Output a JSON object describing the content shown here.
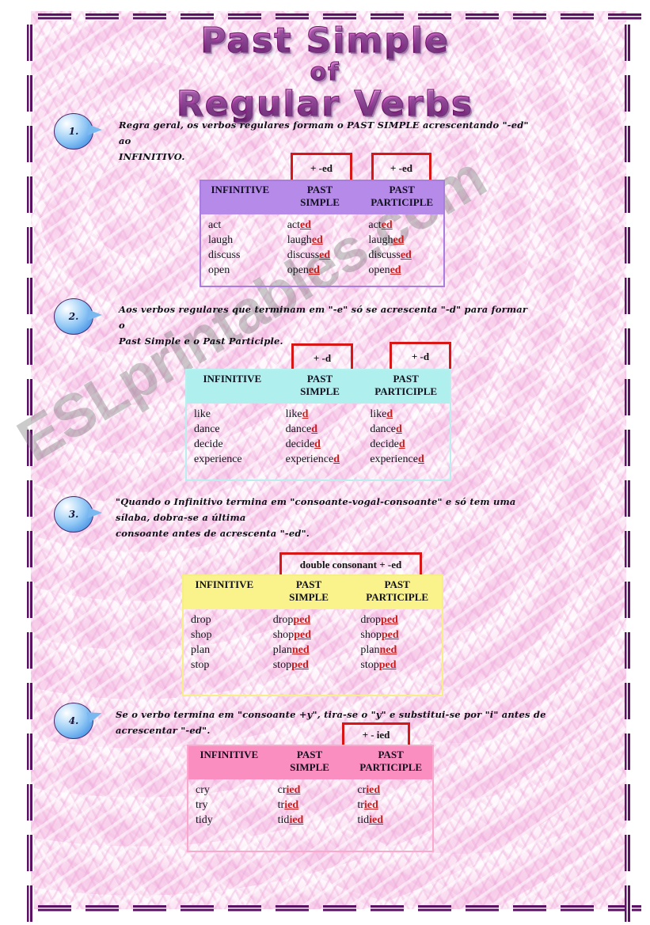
{
  "document": {
    "title_lines": [
      "Past Simple",
      "of",
      "Regular Verbs"
    ],
    "watermark": "ESLprintables.com",
    "language": "Portuguese",
    "colors": {
      "paper": "#fbe3f3",
      "frame": "#5b1163",
      "suffix_red": "#cc1b1b",
      "tag_border": "#d81616",
      "header_purple": "#b58ae8",
      "header_cyan": "#aff0ee",
      "header_yellow": "#faf38b",
      "header_pink": "#fb8ec0",
      "bubble_blue": "#4f9ae8"
    }
  },
  "column_headers": {
    "infinitive": "INFINITIVE",
    "past_simple_line1": "PAST",
    "past_simple_line2": "SIMPLE",
    "past_participle_line1": "PAST",
    "past_participle_line2": "PARTICIPLE"
  },
  "sections": [
    {
      "number": "1.",
      "instruction_line1": "Regra geral, os verbos regulares formam o PAST SIMPLE acrescentando \"-ed\" ao",
      "instruction_line2": "INFINITIVO.",
      "tags": [
        "+ -ed",
        "+ -ed"
      ],
      "theme": "purple",
      "rows": [
        {
          "infinitive": "act",
          "ps_stem": "act",
          "ps_sfx": "ed",
          "pp_stem": "act",
          "pp_sfx": "ed"
        },
        {
          "infinitive": "laugh",
          "ps_stem": "laugh",
          "ps_sfx": "ed",
          "pp_stem": "laugh",
          "pp_sfx": "ed"
        },
        {
          "infinitive": "discuss",
          "ps_stem": "discuss",
          "ps_sfx": "ed",
          "pp_stem": "discuss",
          "pp_sfx": "ed"
        },
        {
          "infinitive": "open",
          "ps_stem": "open",
          "ps_sfx": "ed",
          "pp_stem": "open",
          "pp_sfx": "ed"
        }
      ]
    },
    {
      "number": "2.",
      "instruction_line1": "Aos verbos regulares que terminam em \"-e\" só se acrescenta \"-d\" para formar o",
      "instruction_line2": "Past Simple e o Past Participle.",
      "tags": [
        "+ -d",
        "+ -d"
      ],
      "theme": "cyan",
      "rows": [
        {
          "infinitive": "like",
          "ps_stem": "like",
          "ps_sfx": "d",
          "pp_stem": "like",
          "pp_sfx": "d"
        },
        {
          "infinitive": "dance",
          "ps_stem": "dance",
          "ps_sfx": "d",
          "pp_stem": "dance",
          "pp_sfx": "d"
        },
        {
          "infinitive": "decide",
          "ps_stem": "decide",
          "ps_sfx": "d",
          "pp_stem": "decide",
          "pp_sfx": "d"
        },
        {
          "infinitive": "experience",
          "ps_stem": "experience",
          "ps_sfx": "d",
          "pp_stem": "experience",
          "pp_sfx": "d"
        }
      ]
    },
    {
      "number": "3.",
      "instruction_line1": "\"Quando o Infinitivo termina em \"consoante-vogal-consoante\" e só tem uma sílaba, dobra-se a última",
      "instruction_line2": "consoante antes de acrescenta \"-ed\".",
      "tags": [
        "double consonant + -ed"
      ],
      "theme": "yellow",
      "rows": [
        {
          "infinitive": "drop",
          "ps_stem": "drop",
          "ps_sfx": "ped",
          "pp_stem": "drop",
          "pp_sfx": "ped"
        },
        {
          "infinitive": "shop",
          "ps_stem": "shop",
          "ps_sfx": "ped",
          "pp_stem": "shop",
          "pp_sfx": "ped"
        },
        {
          "infinitive": "plan",
          "ps_stem": "plan",
          "ps_sfx": "ned",
          "pp_stem": "plan",
          "pp_sfx": "ned"
        },
        {
          "infinitive": "stop",
          "ps_stem": "stop",
          "ps_sfx": "ped",
          "pp_stem": "stop",
          "pp_sfx": "ped"
        }
      ]
    },
    {
      "number": "4.",
      "instruction_line1": "Se o verbo termina em \"consoante +y\", tira-se o \"y\" e substitui-se por \"i\" antes de acrescentar \"-ed\".",
      "instruction_line2": "",
      "tags": [
        "+ - ied"
      ],
      "theme": "pink",
      "rows": [
        {
          "infinitive": "cry",
          "ps_stem": "cr",
          "ps_sfx": "ied",
          "pp_stem": "cr",
          "pp_sfx": "ied"
        },
        {
          "infinitive": "try",
          "ps_stem": "tr",
          "ps_sfx": "ied",
          "pp_stem": "tr",
          "pp_sfx": "ied"
        },
        {
          "infinitive": "tidy",
          "ps_stem": "tid",
          "ps_sfx": "ied",
          "pp_stem": "tid",
          "pp_sfx": "ied"
        }
      ]
    }
  ]
}
